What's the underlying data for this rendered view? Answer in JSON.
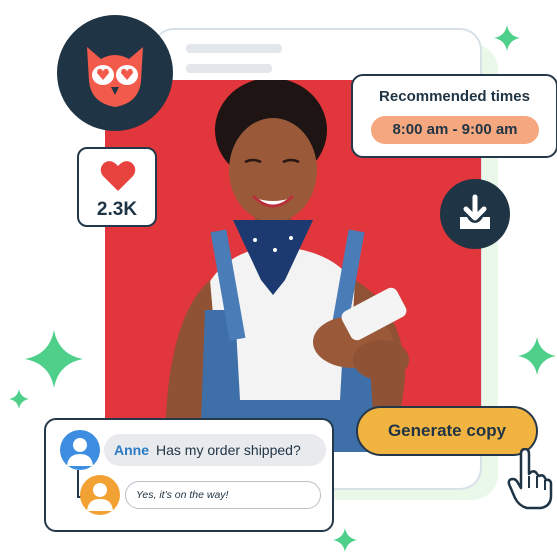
{
  "post": {
    "placeholder_lines": 2
  },
  "like_card": {
    "icon": "heart-icon",
    "count": "2.3K",
    "color": "#e8423f"
  },
  "recommended": {
    "title": "Recommended times",
    "time_range": "8:00 am - 9:00 am"
  },
  "download": {
    "icon": "download-tray-icon"
  },
  "generate": {
    "label": "Generate copy"
  },
  "chat": {
    "incoming": {
      "name": "Anne",
      "message": "Has my order shipped?"
    },
    "reply": {
      "message": "Yes, it's on the way!"
    }
  },
  "colors": {
    "navy": "#1f3444",
    "photo_bg": "#e0363c",
    "accent_orange": "#f5a780",
    "button_yellow": "#f2b441",
    "sparkle_green": "#4fd08a"
  }
}
